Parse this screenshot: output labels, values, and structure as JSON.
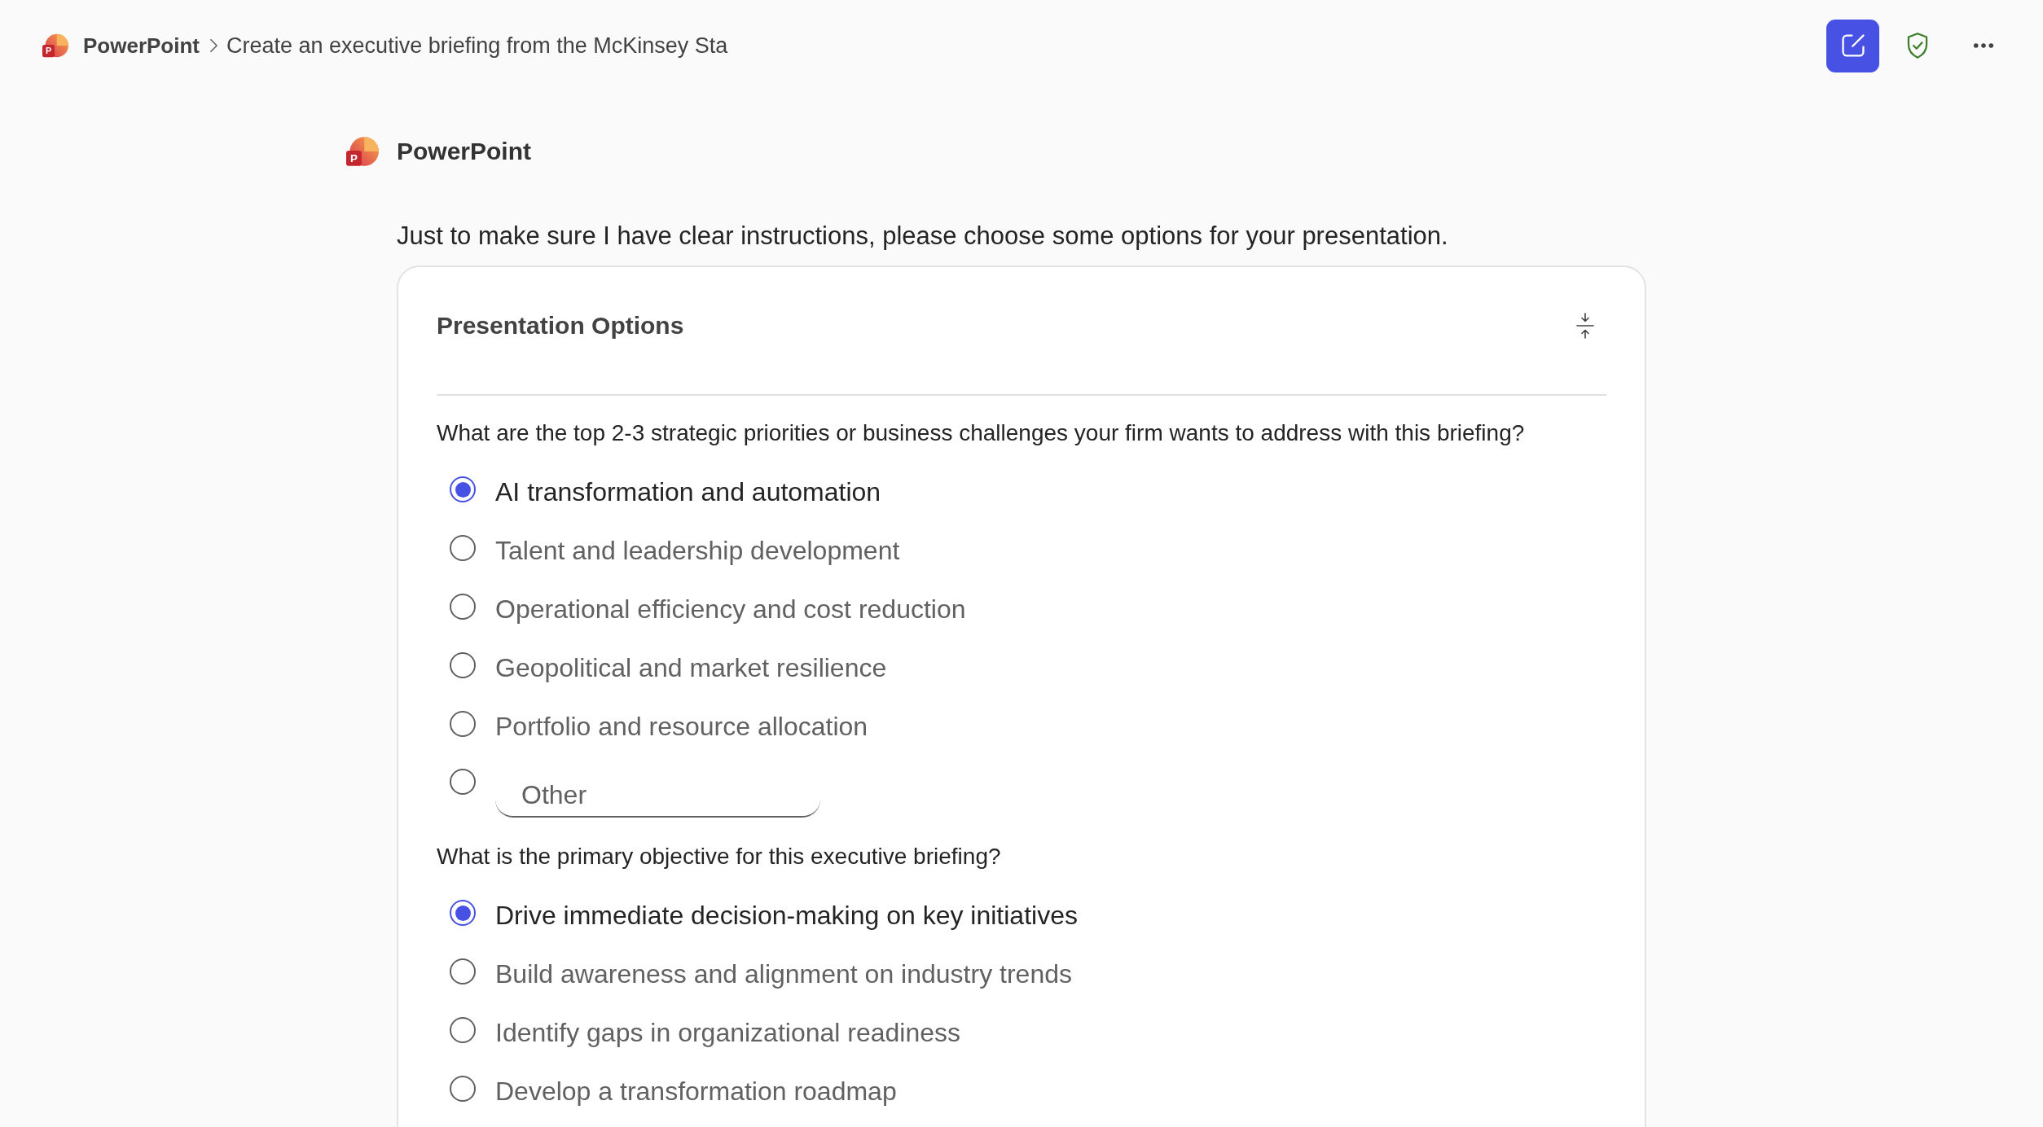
{
  "breadcrumb": {
    "logo_letter": "P",
    "app": "PowerPoint",
    "title": "Create an executive briefing from the McKinsey Sta"
  },
  "message": {
    "logo_letter": "P",
    "sender": "PowerPoint",
    "text": "Just to make sure I have clear instructions, please choose some options for your presentation."
  },
  "card": {
    "title": "Presentation Options",
    "expanded": true,
    "questions": [
      {
        "text": "What are the top 2-3 strategic priorities or business challenges your firm wants to address with this briefing?",
        "options": [
          {
            "kind": "choice",
            "label": "AI transformation and automation",
            "selected": true
          },
          {
            "kind": "choice",
            "label": "Talent and leadership development",
            "selected": false
          },
          {
            "kind": "choice",
            "label": "Operational efficiency and cost reduction",
            "selected": false
          },
          {
            "kind": "choice",
            "label": "Geopolitical and market resilience",
            "selected": false
          },
          {
            "kind": "choice",
            "label": "Portfolio and resource allocation",
            "selected": false
          },
          {
            "kind": "other",
            "placeholder": "Other",
            "selected": false
          }
        ]
      },
      {
        "text": "What is the primary objective for this executive briefing?",
        "options": [
          {
            "kind": "choice",
            "label": "Drive immediate decision-making on key initiatives",
            "selected": true
          },
          {
            "kind": "choice",
            "label": "Build awareness and alignment on industry trends",
            "selected": false
          },
          {
            "kind": "choice",
            "label": "Identify gaps in organizational readiness",
            "selected": false
          },
          {
            "kind": "choice",
            "label": "Develop a transformation roadmap",
            "selected": false
          }
        ]
      }
    ]
  }
}
